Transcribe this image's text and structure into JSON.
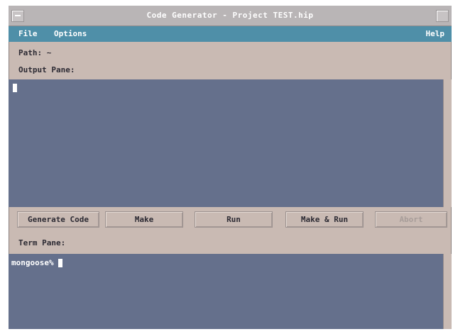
{
  "window": {
    "title": "Code Generator - Project TEST.hip"
  },
  "menubar": {
    "file": "File",
    "options": "Options",
    "help": "Help"
  },
  "info": {
    "path_label": "Path: ~",
    "output_pane_label": "Output Pane:"
  },
  "buttons": {
    "generate_code": "Generate Code",
    "make": "Make",
    "run": "Run",
    "make_and_run": "Make & Run",
    "abort": "Abort"
  },
  "term": {
    "label": "Term Pane:",
    "prompt": "mongoose%"
  },
  "colors": {
    "menubar": "#4f8fa8",
    "panel": "#c9bab3",
    "pane": "#65708c"
  }
}
